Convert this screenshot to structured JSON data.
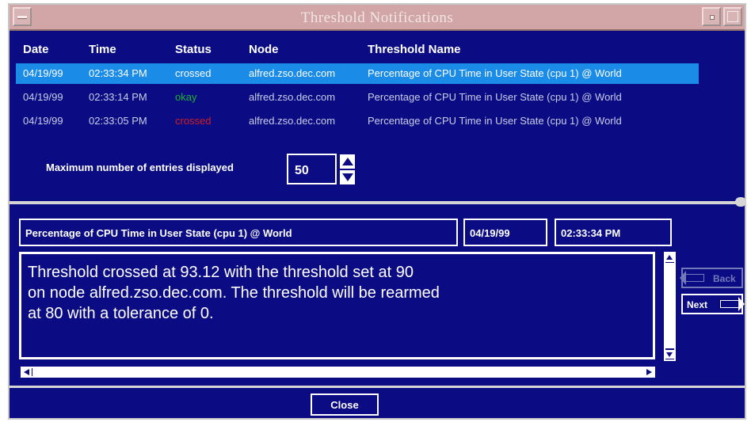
{
  "window": {
    "title": "Threshold Notifications"
  },
  "table": {
    "headers": {
      "date": "Date",
      "time": "Time",
      "status": "Status",
      "node": "Node",
      "threshold": "Threshold Name"
    },
    "rows": [
      {
        "date": "04/19/99",
        "time": "02:33:34 PM",
        "status": "crossed",
        "node": "alfred.zso.dec.com",
        "threshold": "Percentage of CPU Time in User State  (cpu 1) @  World"
      },
      {
        "date": "04/19/99",
        "time": "02:33:14 PM",
        "status": "okay",
        "node": "alfred.zso.dec.com",
        "threshold": "Percentage of CPU Time in User State  (cpu 1) @  World"
      },
      {
        "date": "04/19/99",
        "time": "02:33:05 PM",
        "status": "crossed",
        "node": "alfred.zso.dec.com",
        "threshold": "Percentage of CPU Time in User State  (cpu 1) @  World"
      }
    ]
  },
  "max_entries": {
    "label": "Maximum number of entries displayed",
    "value": "50"
  },
  "detail": {
    "name": "Percentage of CPU Time in User State  (cpu 1) @  World",
    "date": "04/19/99",
    "time": "02:33:34 PM",
    "message": "Threshold crossed at 93.12 with the threshold set at 90\non node alfred.zso.dec.com.  The threshold will be rearmed\nat 80 with a tolerance of 0."
  },
  "buttons": {
    "back": "Back",
    "next": "Next",
    "close": "Close"
  },
  "colors": {
    "background": "#0b0c84",
    "selection": "#1a8ce8",
    "okay": "#1db531",
    "crossed": "#d21e1e",
    "titlebar": "#d2a6a6"
  },
  "icons": {
    "spin_up": "arrow-up-icon",
    "spin_down": "arrow-down-icon",
    "back": "arrow-left-icon",
    "next": "arrow-right-icon"
  }
}
